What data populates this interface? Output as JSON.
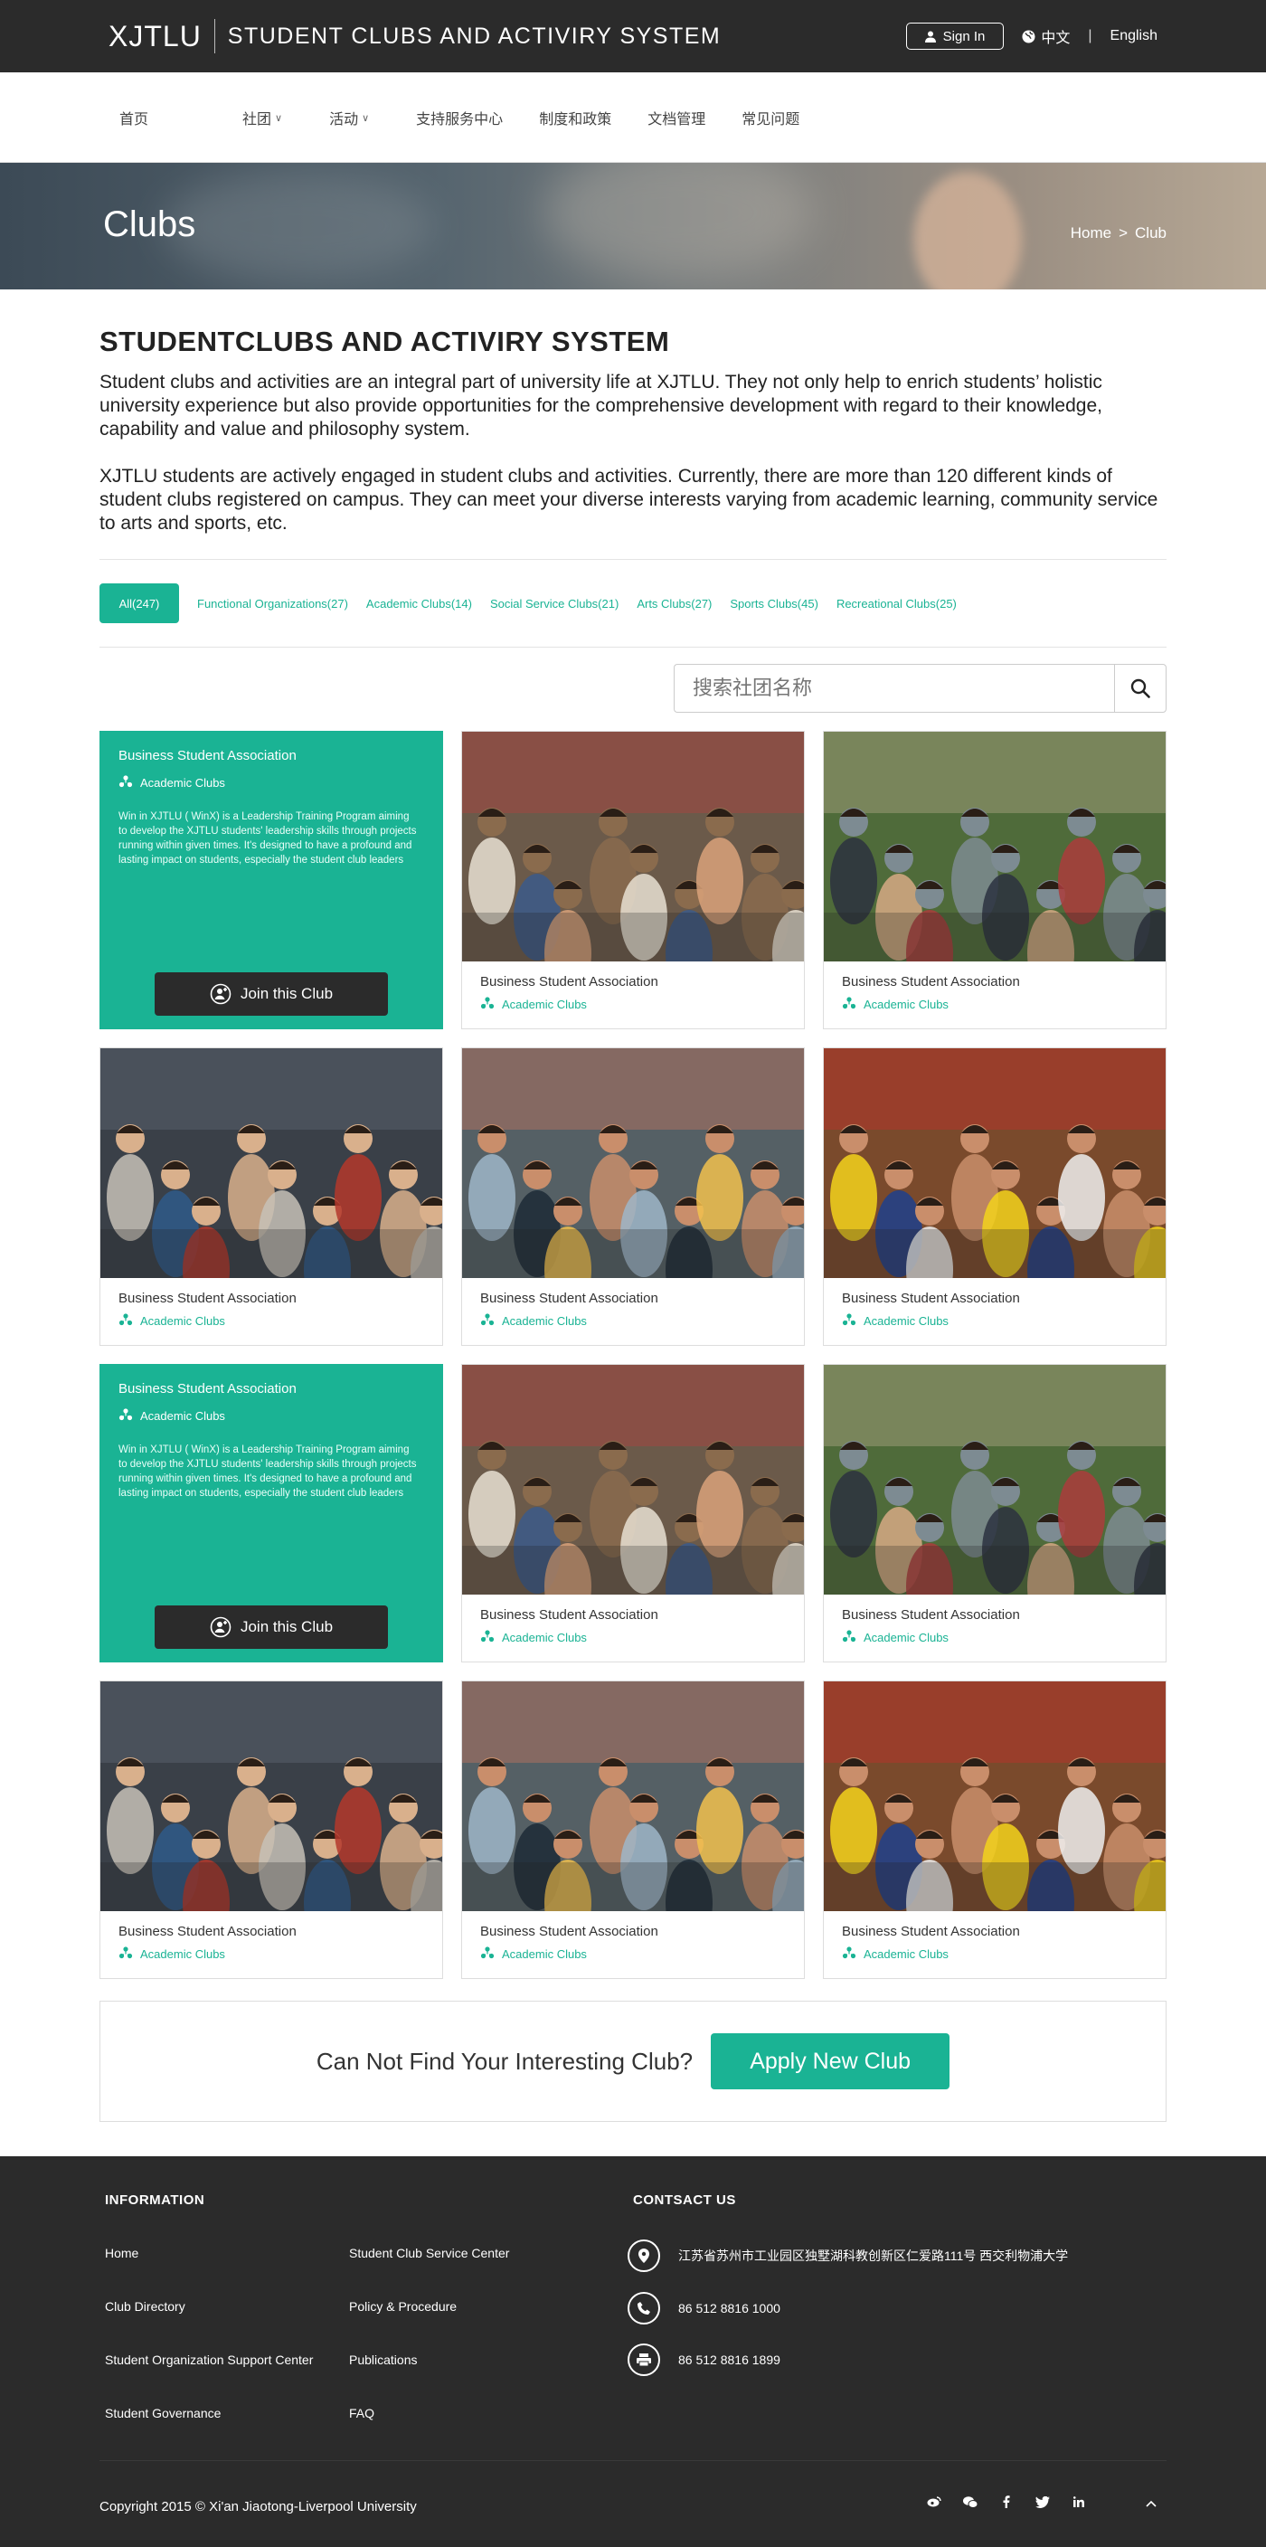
{
  "header": {
    "logo": "XJTLU",
    "system_title": "STUDENT CLUBS AND ACTIVIRY SYSTEM",
    "sign_in": "Sign In",
    "lang_cn": "中文",
    "separator": "|",
    "lang_en": "English"
  },
  "nav": {
    "items": [
      {
        "label": "首页"
      },
      {
        "label": "社团",
        "has_dropdown": true
      },
      {
        "label": "活动",
        "has_dropdown": true
      },
      {
        "label": "支持服务中心"
      },
      {
        "label": "制度和政策"
      },
      {
        "label": "文档管理"
      },
      {
        "label": "常见问题"
      }
    ]
  },
  "banner": {
    "title": "Clubs",
    "breadcrumb": [
      "Home",
      ">",
      "Club"
    ]
  },
  "intro": {
    "heading": "STUDENTCLUBS AND ACTIVIRY SYSTEM",
    "p1": "Student clubs and activities are an integral part of university life at XJTLU. They not only help to enrich students’ holistic university experience but also provide opportunities for the comprehensive development with regard to their knowledge, capability and value and philosophy system.",
    "p2": "XJTLU students are actively engaged in student clubs and activities. Currently, there are more than 120 different kinds of student clubs registered on campus. They can meet your diverse interests varying from academic learning, community service to arts and sports, etc."
  },
  "filters": [
    {
      "label": "All(247)",
      "active": true
    },
    {
      "label": "Functional Organizations(27)"
    },
    {
      "label": "Academic Clubs(14)"
    },
    {
      "label": "Social Service Clubs(21)"
    },
    {
      "label": "Arts Clubs(27)"
    },
    {
      "label": "Sports Clubs(45)"
    },
    {
      "label": "Recreational Clubs(25)"
    }
  ],
  "search": {
    "placeholder": "搜索社团名称",
    "icon": "search-icon"
  },
  "featured": {
    "name": "Business Student Association",
    "category": "Academic Clubs",
    "description": "Win in XJTLU ( WinX) is a Leadership Training Program aiming to develop the XJTLU students' leadership skills through projects running within given times. It's designed to have a profound and lasting impact on students, especially the student club leaders",
    "join_label": "Join this Club"
  },
  "clubs": [
    {
      "name": "Business Student Association",
      "category": "Academic Clubs",
      "photo": "students-high-five"
    },
    {
      "name": "Business Student Association",
      "category": "Academic Clubs",
      "photo": "students-laptop"
    },
    {
      "name": "Business Student Association",
      "category": "Academic Clubs",
      "photo": "students-study-circle"
    },
    {
      "name": "Business Student Association",
      "category": "Academic Clubs",
      "photo": "students-group-sofa"
    },
    {
      "name": "Business Student Association",
      "category": "Academic Clubs",
      "photo": "students-flags"
    }
  ],
  "cta": {
    "question": "Can Not Find Your Interesting Club?",
    "button": "Apply New Club"
  },
  "footer": {
    "info_heading": "INFORMATION",
    "links_col1": [
      "Home",
      "Club Directory",
      "Student Organization Support Center",
      "Student Governance"
    ],
    "links_col2": [
      "Student Club Service Center",
      "Policy & Procedure",
      "Publications",
      "FAQ"
    ],
    "contact_heading": "CONTSACT US",
    "address": "江苏省苏州市工业园区独墅湖科教创新区仁爱路111号 西交利物浦大学",
    "phone": "86 512 8816 1000",
    "fax": "86 512 8816 1899",
    "copyright": "Copyright 2015 © Xi'an Jiaotong-Liverpool University",
    "social": [
      "weibo-icon",
      "wechat-icon",
      "facebook-icon",
      "twitter-icon",
      "linkedin-icon",
      "back-to-top-icon"
    ]
  },
  "colors": {
    "accent": "#1ab394",
    "dark": "#2b2b2b"
  }
}
